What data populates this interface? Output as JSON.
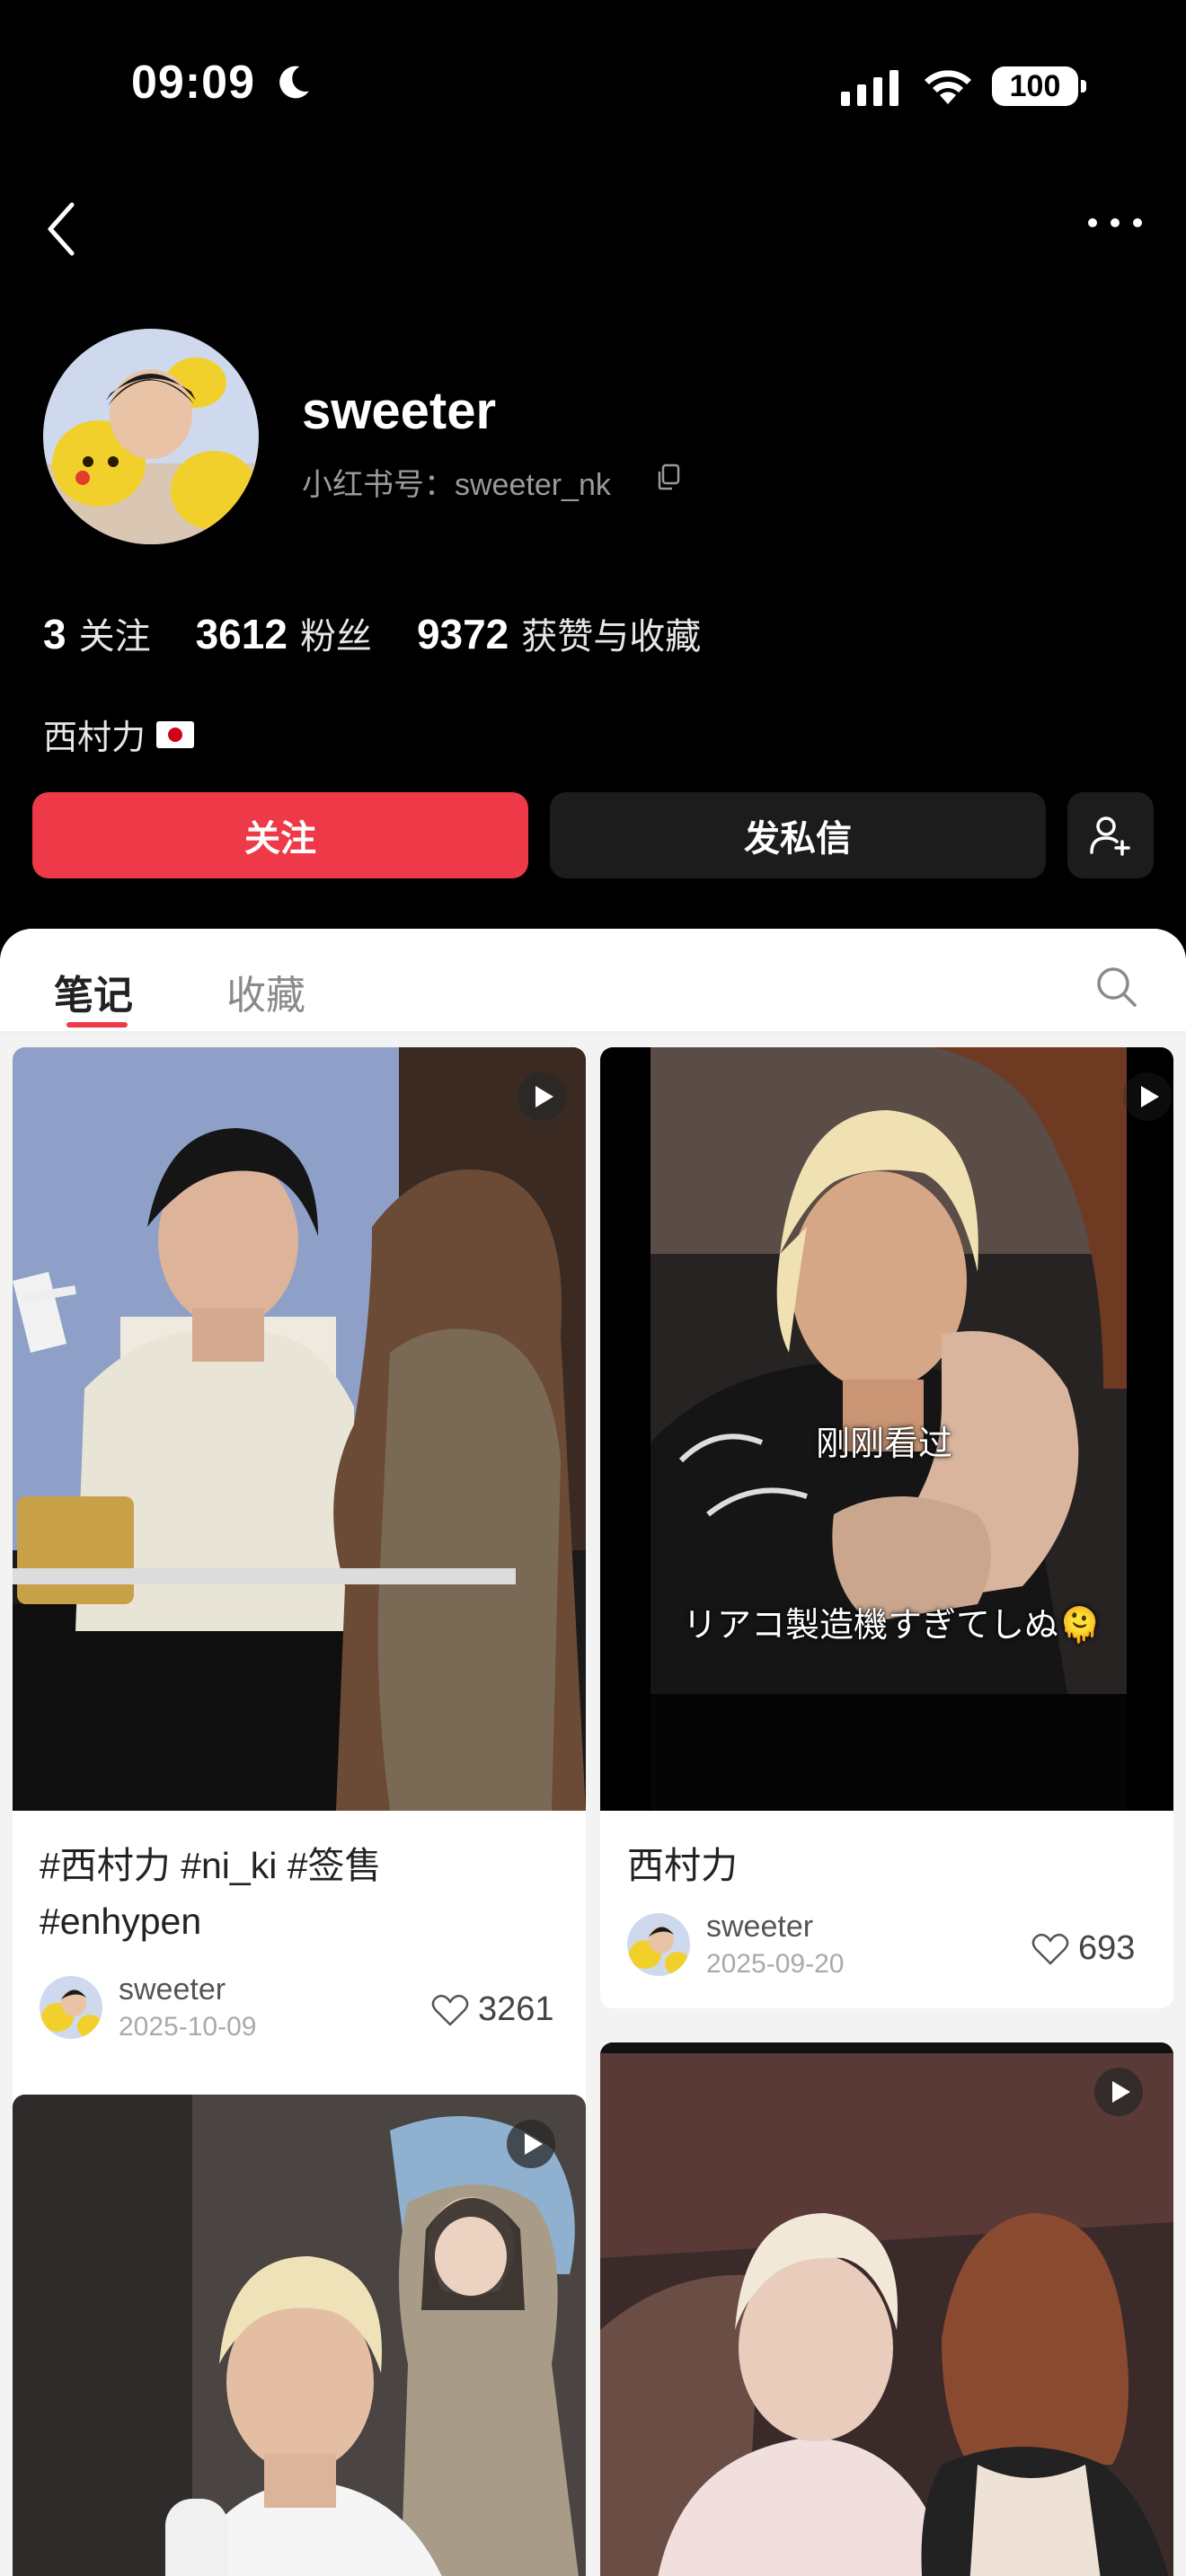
{
  "status_bar": {
    "time": "09:09",
    "battery": "100"
  },
  "profile": {
    "name": "sweeter",
    "id_label": "小红书号：sweeter_nk",
    "bio": "西村力",
    "bio_flag": "japan-flag-icon"
  },
  "stats": [
    {
      "num": "3",
      "label": "关注"
    },
    {
      "num": "3612",
      "label": "粉丝"
    },
    {
      "num": "9372",
      "label": "获赞与收藏"
    }
  ],
  "actions": {
    "follow": "关注",
    "message": "发私信"
  },
  "tabs": {
    "notes": "笔记",
    "collect": "收藏"
  },
  "notes": [
    {
      "title_line1": "#西村力 #ni_ki #签售",
      "title_line2": "#enhypen",
      "author": "sweeter",
      "date": "2025-10-09",
      "likes": "3261"
    },
    {
      "title_line1": "西村力",
      "author": "sweeter",
      "date": "2025-09-20",
      "likes": "693",
      "overlay_top": "刚刚看过",
      "overlay_caption": "リアコ製造機すぎてしぬ🫠"
    },
    {},
    {}
  ],
  "colors": {
    "accent": "#ee3a48",
    "background": "#000000",
    "sheet": "#f3f3f3"
  }
}
